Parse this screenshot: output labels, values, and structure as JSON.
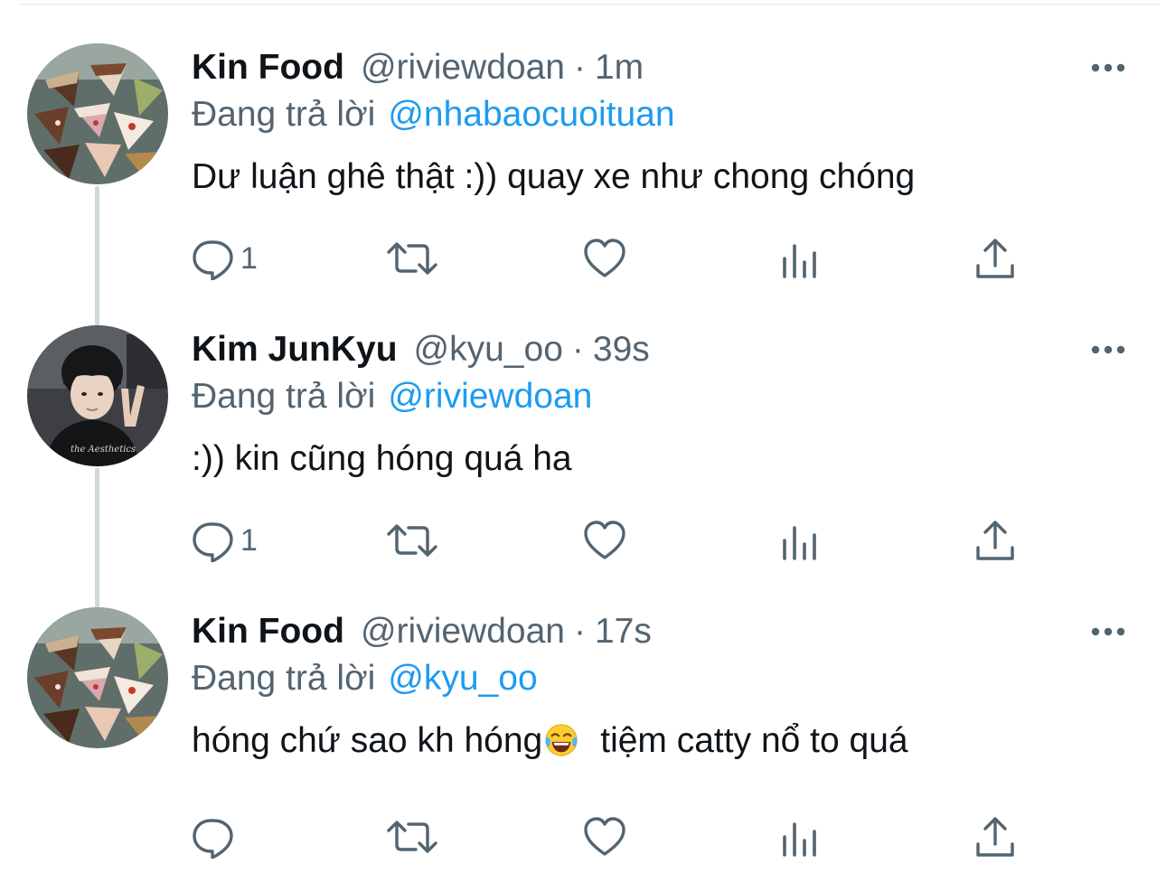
{
  "tweets": [
    {
      "display_name": "Kin Food",
      "handle": "@riviewdoan",
      "separator": "·",
      "time": "1m",
      "reply_label": "Đang trả lời",
      "reply_to": "@nhabaocuoituan",
      "text": "Dư luận ghê thật :)) quay xe như chong chóng",
      "emoji": "",
      "text_after": "",
      "reply_count": "1",
      "avatar": "cakes-photo"
    },
    {
      "display_name": "Kim JunKyu",
      "handle": "@kyu_oo",
      "separator": "·",
      "time": "39s",
      "reply_label": "Đang trả lời",
      "reply_to": "@riviewdoan",
      "text": ":)) kin cũng hóng quá ha",
      "emoji": "",
      "text_after": "",
      "reply_count": "1",
      "avatar": "person-photo"
    },
    {
      "display_name": "Kin Food",
      "handle": "@riviewdoan",
      "separator": "·",
      "time": "17s",
      "reply_label": "Đang trả lời",
      "reply_to": "@kyu_oo",
      "text": "hóng chứ sao kh hóng",
      "emoji": "face-with-tears-of-joy",
      "text_after": "tiệm catty nổ to quá",
      "reply_count": "",
      "avatar": "cakes-photo"
    }
  ],
  "icons": {
    "reply": "speech-bubble-icon",
    "retweet": "retweet-icon",
    "like": "heart-icon",
    "views": "bar-chart-icon",
    "share": "share-icon",
    "more": "more-dots-icon"
  },
  "colors": {
    "text": "#0f1419",
    "secondary": "#536471",
    "link": "#1d9bf0",
    "thread_line": "#cfd9de"
  }
}
